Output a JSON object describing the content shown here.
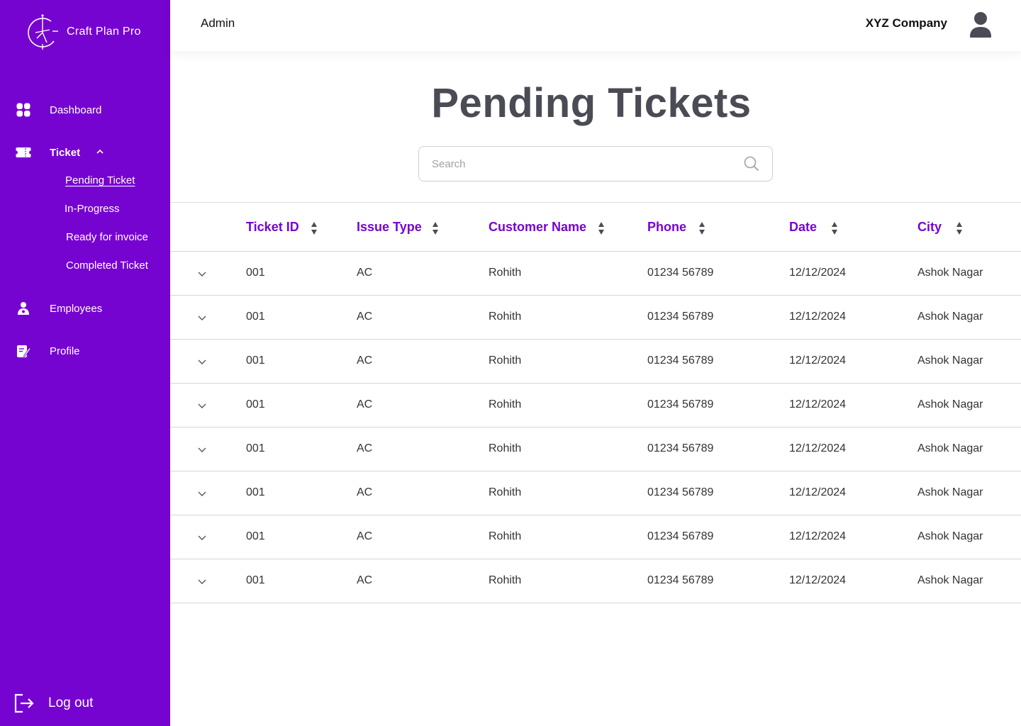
{
  "brand": {
    "name": "Craft Plan Pro"
  },
  "sidebar": {
    "items": [
      {
        "label": "Dashboard",
        "icon": "dashboard-icon"
      },
      {
        "label": "Ticket",
        "icon": "ticket-icon"
      },
      {
        "label": "Employees",
        "icon": "employees-icon"
      },
      {
        "label": "Profile",
        "icon": "profile-icon"
      }
    ],
    "ticket_submenu": [
      "Pending Ticket",
      "In-Progress",
      "Ready for invoice",
      "Completed Ticket"
    ],
    "logout_label": "Log out"
  },
  "header": {
    "role": "Admin",
    "company": "XYZ Company"
  },
  "main": {
    "title": "Pending Tickets",
    "search": {
      "placeholder": "Search",
      "value": ""
    }
  },
  "table": {
    "columns": [
      "Ticket ID",
      "Issue Type",
      "Customer Name",
      "Phone",
      "Date",
      "City"
    ],
    "rows": [
      [
        "001",
        "AC",
        "Rohith",
        "01234 56789",
        "12/12/2024",
        "Ashok Nagar"
      ],
      [
        "001",
        "AC",
        "Rohith",
        "01234 56789",
        "12/12/2024",
        "Ashok Nagar"
      ],
      [
        "001",
        "AC",
        "Rohith",
        "01234 56789",
        "12/12/2024",
        "Ashok Nagar"
      ],
      [
        "001",
        "AC",
        "Rohith",
        "01234 56789",
        "12/12/2024",
        "Ashok Nagar"
      ],
      [
        "001",
        "AC",
        "Rohith",
        "01234 56789",
        "12/12/2024",
        "Ashok Nagar"
      ],
      [
        "001",
        "AC",
        "Rohith",
        "01234 56789",
        "12/12/2024",
        "Ashok Nagar"
      ],
      [
        "001",
        "AC",
        "Rohith",
        "01234 56789",
        "12/12/2024",
        "Ashok Nagar"
      ],
      [
        "001",
        "AC",
        "Rohith",
        "01234 56789",
        "12/12/2024",
        "Ashok Nagar"
      ]
    ]
  },
  "colors": {
    "sidebar": "#7604D1",
    "accent": "#7604D1",
    "title": "#4b4b55"
  }
}
